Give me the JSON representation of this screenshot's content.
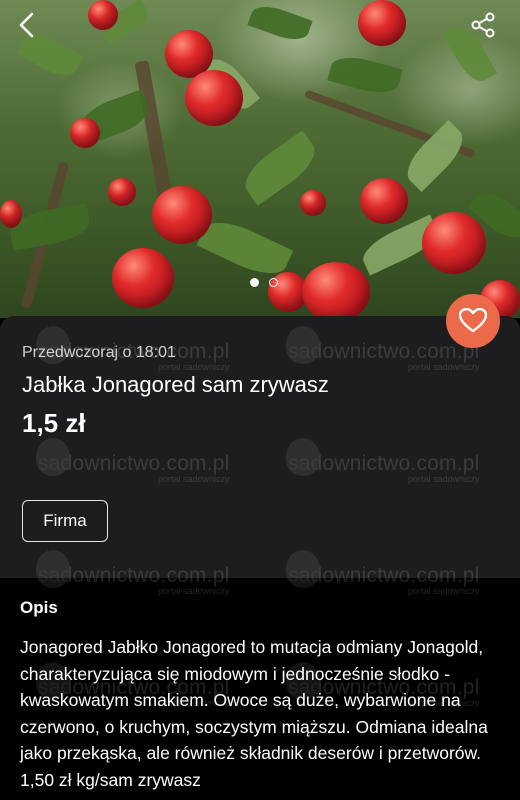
{
  "listing": {
    "posted": "Przedwczoraj o 18:01",
    "title": "Jabłka Jonagored sam zrywasz",
    "price": "1,5 zł",
    "seller_type_button": "Firma"
  },
  "gallery": {
    "dots": [
      true,
      false
    ]
  },
  "description": {
    "heading": "Opis",
    "text": "Jonagored Jabłko Jonagored to mutacja odmiany Jonagold, charakteryzująca się miodowym i jednocześnie słodko -kwaskowatym smakiem. Owoce są duże, wybarwione na czerwono, o kruchym, soczystym miąższu. Odmiana idealna jako przekąska, ale również składnik deserów i przetworów. 1,50 zł kg/sam zrywasz"
  },
  "watermark": {
    "main": "sadownictwo.com.pl",
    "sub": "portal sadowniczy"
  },
  "icons": {
    "back": "back-arrow-icon",
    "share": "share-icon",
    "favorite": "heart-icon"
  },
  "colors": {
    "favorite_button": "#ea6a4a",
    "card_background": "#1d1d20",
    "page_background": "#000000"
  }
}
